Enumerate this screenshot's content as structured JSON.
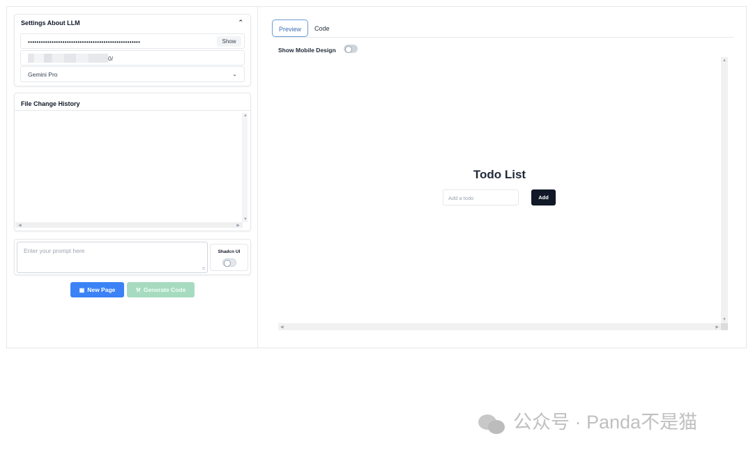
{
  "settings": {
    "title": "Settings About LLM",
    "api_key_masked": "••••••••••••••••••••••••••••••••••••••••••••••••••••",
    "show_label": "Show",
    "url_tail": "0/",
    "model": "Gemini Pro"
  },
  "history": {
    "title": "File Change History"
  },
  "prompt": {
    "placeholder": "Enter your prompt here",
    "shadcn_label": "Shadcn UI"
  },
  "buttons": {
    "new_page": "New Page",
    "generate": "Generate Code"
  },
  "tabs": {
    "preview": "Preview",
    "code": "Code"
  },
  "mobile": {
    "label": "Show Mobile Design"
  },
  "todo": {
    "title": "Todo List",
    "input_placeholder": "Add a todo",
    "add_label": "Add"
  },
  "watermark": {
    "text": "公众号 · Panda不是猫"
  }
}
